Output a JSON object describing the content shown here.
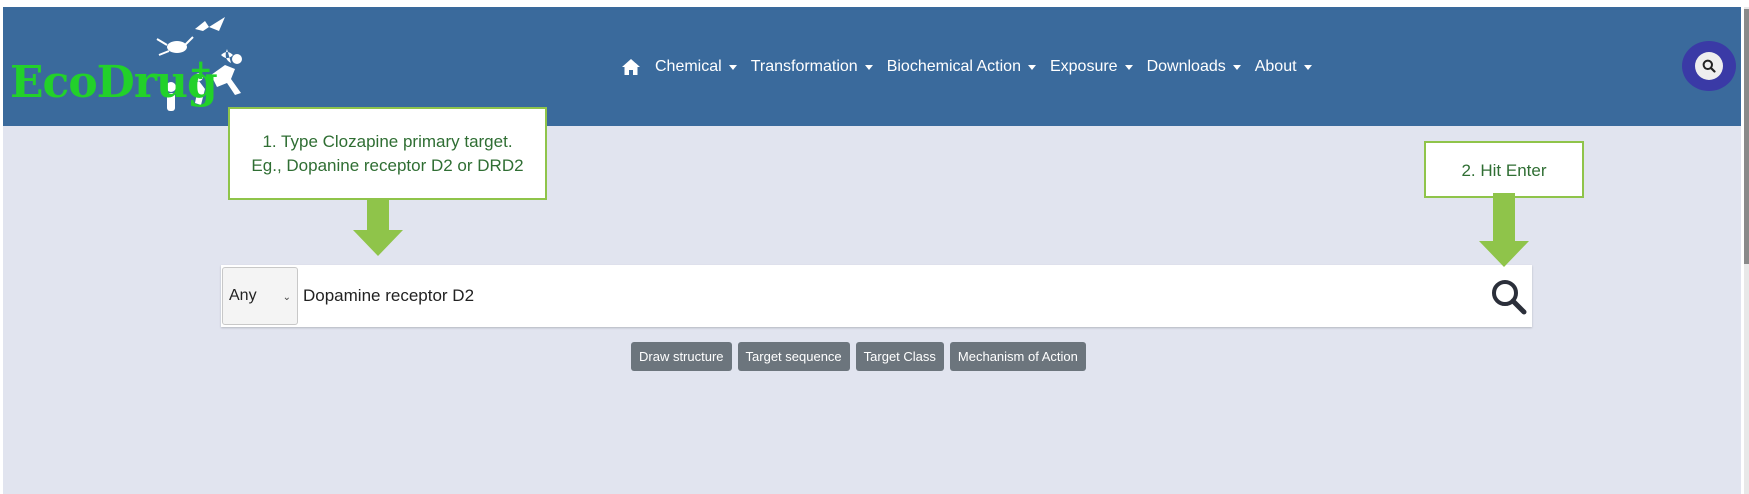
{
  "brand": {
    "name": "EcoDrug",
    "plus": "+",
    "logo_color": "#22d12a"
  },
  "navbar": {
    "background": "#3a6a9c",
    "home_icon": "home-icon",
    "items": [
      {
        "label": "Chemical"
      },
      {
        "label": "Transformation"
      },
      {
        "label": "Biochemical Action"
      },
      {
        "label": "Exposure"
      },
      {
        "label": "Downloads"
      },
      {
        "label": "About"
      }
    ],
    "user_icon": "search-icon"
  },
  "callouts": {
    "step1_line1": "1. Type  Clozapine primary target.",
    "step1_line2": "Eg., Dopanine receptor D2 or DRD2",
    "step2": "2. Hit Enter",
    "border_color": "#8fc44a",
    "text_color": "#2f6e33"
  },
  "search": {
    "scope_selected": "Any",
    "query": "Dopamine receptor D2",
    "submit_icon": "search-icon"
  },
  "buttons": [
    {
      "label": "Draw structure"
    },
    {
      "label": "Target sequence"
    },
    {
      "label": "Target Class"
    },
    {
      "label": "Mechanism of Action"
    }
  ]
}
